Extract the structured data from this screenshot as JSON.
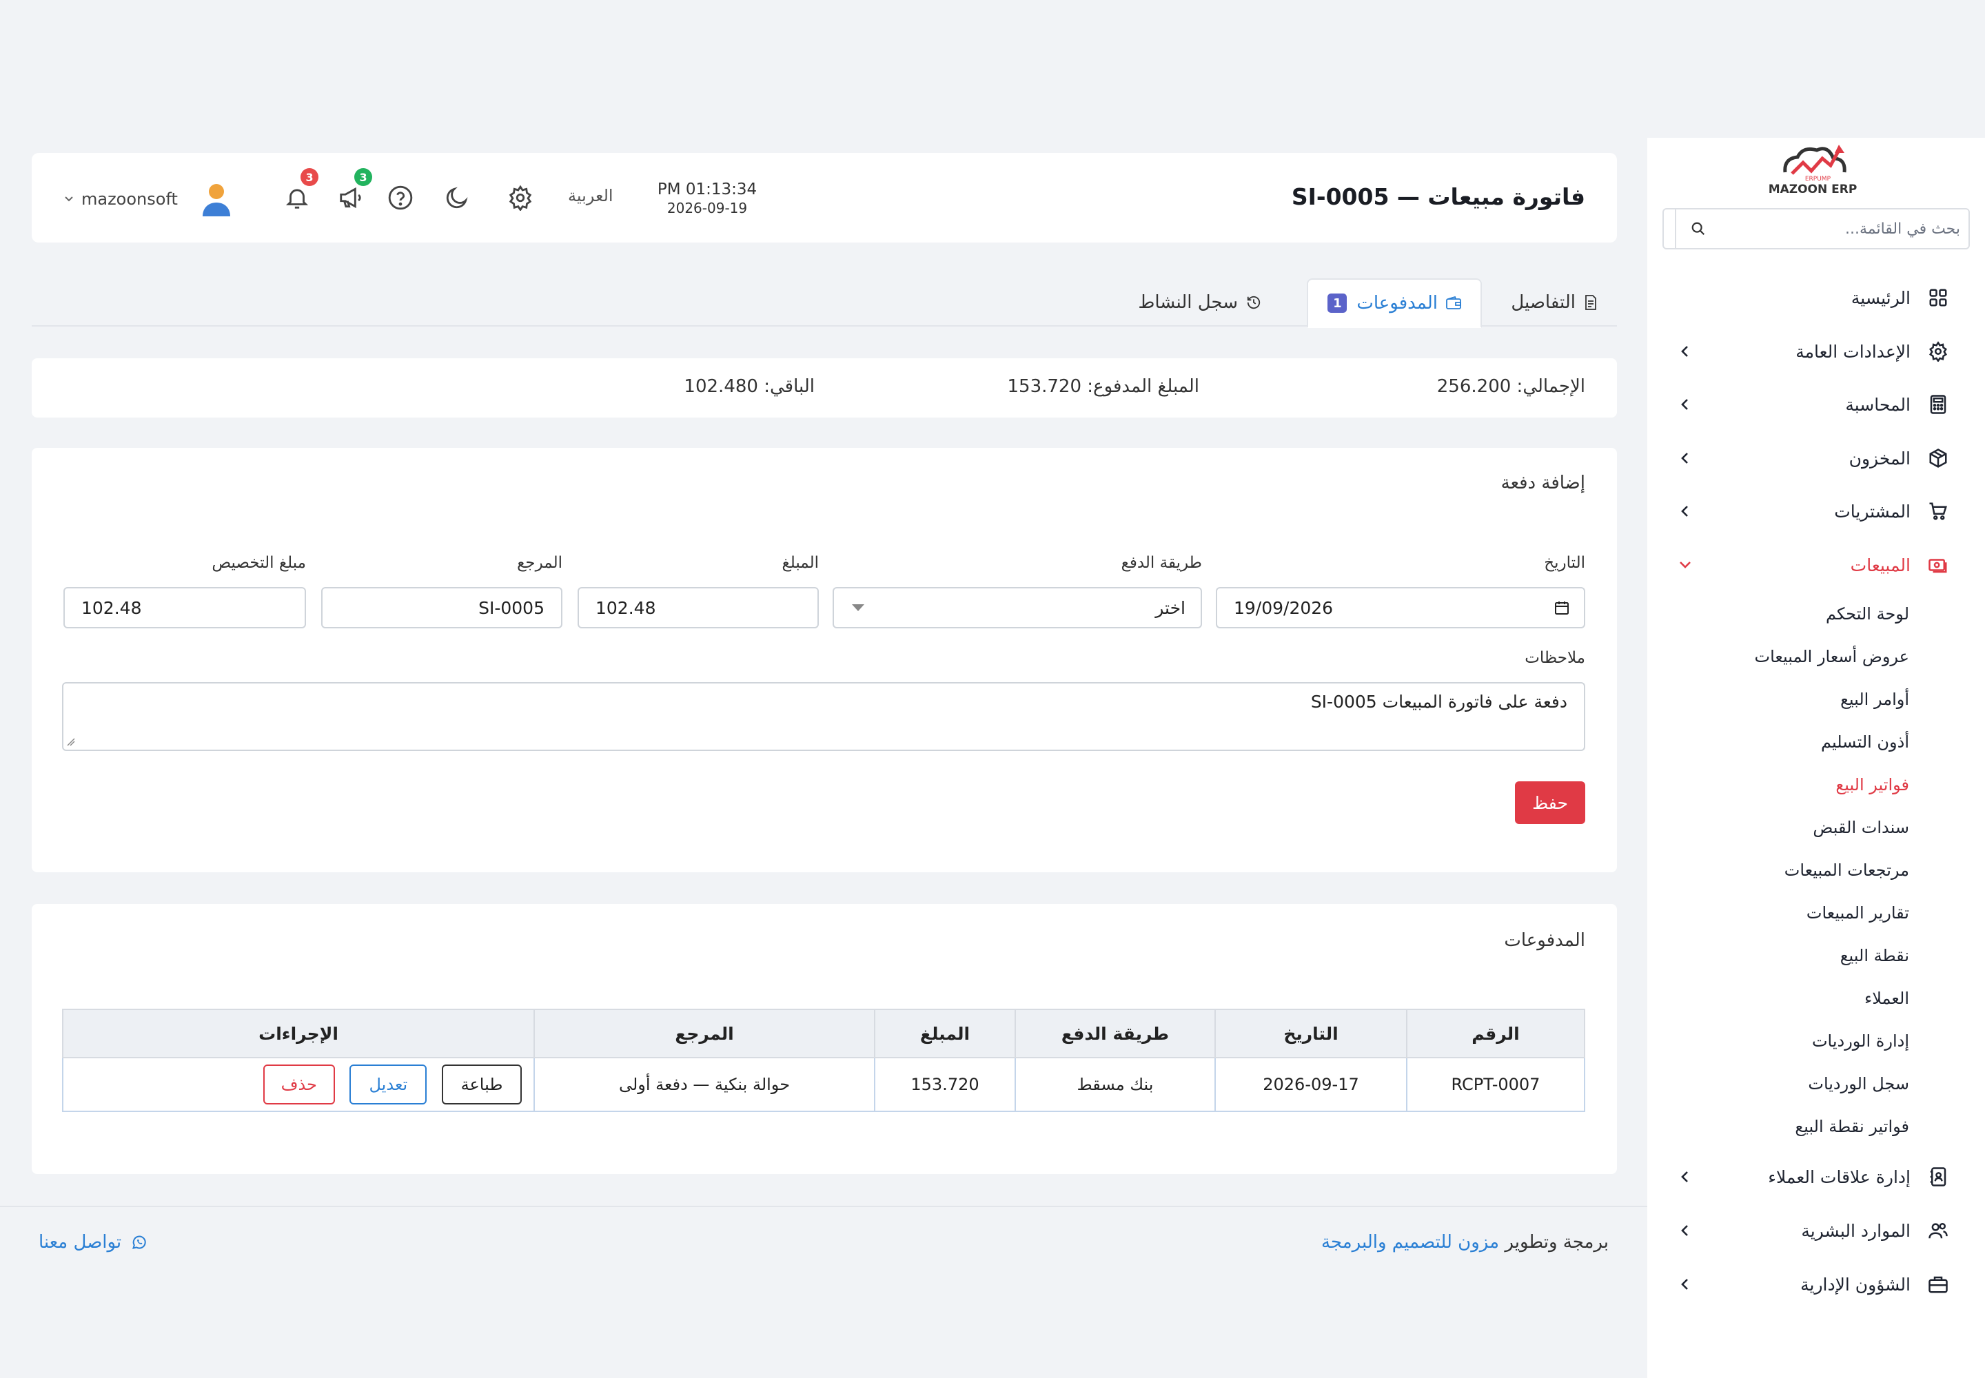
{
  "sidebar": {
    "logo_text": "MAZOON ERP",
    "logo_small": "ERPUMP",
    "search_placeholder": "بحث في القائمة...",
    "items": [
      {
        "label": "الرئيسية",
        "icon": "grid-icon"
      },
      {
        "label": "الإعدادات العامة",
        "icon": "gear-icon"
      },
      {
        "label": "المحاسبة",
        "icon": "calculator-icon"
      },
      {
        "label": "المخزون",
        "icon": "box-icon"
      },
      {
        "label": "المشتريات",
        "icon": "cart-icon"
      },
      {
        "label": "المبيعات",
        "icon": "money-icon"
      },
      {
        "label": "إدارة علاقات العملاء",
        "icon": "contacts-icon"
      },
      {
        "label": "الموارد البشرية",
        "icon": "users-icon"
      },
      {
        "label": "الشؤون الإدارية",
        "icon": "briefcase-icon"
      }
    ],
    "sales_sub": [
      "لوحة التحكم",
      "عروض أسعار المبيعات",
      "أوامر البيع",
      "أذون التسليم",
      "فواتير البيع",
      "سندات القبض",
      "مرتجعات المبيعات",
      "تقارير المبيعات",
      "نقطة البيع",
      "العملاء",
      "إدارة الورديات",
      "سجل الورديات",
      "فواتير نقطة البيع"
    ]
  },
  "header": {
    "title": "فاتورة مبيعات — SI-0005",
    "time": "PM 01:13:34",
    "date": "2026-09-19",
    "language": "العربية",
    "announcements_count": "3",
    "notifications_count": "3",
    "username": "mazoonsoft"
  },
  "tabs": {
    "details": "التفاصيل",
    "payments": "المدفوعات",
    "payments_count": "1",
    "activity": "سجل النشاط"
  },
  "summary": {
    "total": "الإجمالي: 256.200",
    "paid": "المبلغ المدفوع: 153.720",
    "remaining": "الباقي: 102.480"
  },
  "form": {
    "title": "إضافة دفعة",
    "date_label": "التاريخ",
    "date_value": "19/09/2026",
    "method_label": "طريقة الدفع",
    "method_value": "اختر",
    "amount_label": "المبلغ",
    "amount_value": "102.48",
    "reference_label": "المرجع",
    "reference_value": "SI-0005",
    "allocation_label": "مبلغ التخصيص",
    "allocation_value": "102.48",
    "notes_label": "ملاحظات",
    "notes_value": "دفعة على فاتورة المبيعات SI-0005",
    "save": "حفظ"
  },
  "payments": {
    "title": "المدفوعات",
    "columns": [
      "الرقم",
      "التاريخ",
      "طريقة الدفع",
      "المبلغ",
      "المرجع",
      "الإجراءات"
    ],
    "rows": [
      {
        "number": "RCPT-0007",
        "date": "2026-09-17",
        "method": "بنك مسقط",
        "amount": "153.720",
        "reference": "حوالة بنكية — دفعة أولى"
      }
    ],
    "actions": {
      "print": "طباعة",
      "edit": "تعديل",
      "delete": "حذف"
    }
  },
  "footer": {
    "credit_prefix": "برمجة وتطوير",
    "credit_link": "مزون للتصميم والبرمجة",
    "contact": "تواصل معنا"
  },
  "colors": {
    "accent_red": "#e03a45",
    "link_blue": "#2a7fd4",
    "badge_red": "#e84a4a",
    "badge_green": "#22b35e",
    "tab_badge": "#5b63c9"
  }
}
